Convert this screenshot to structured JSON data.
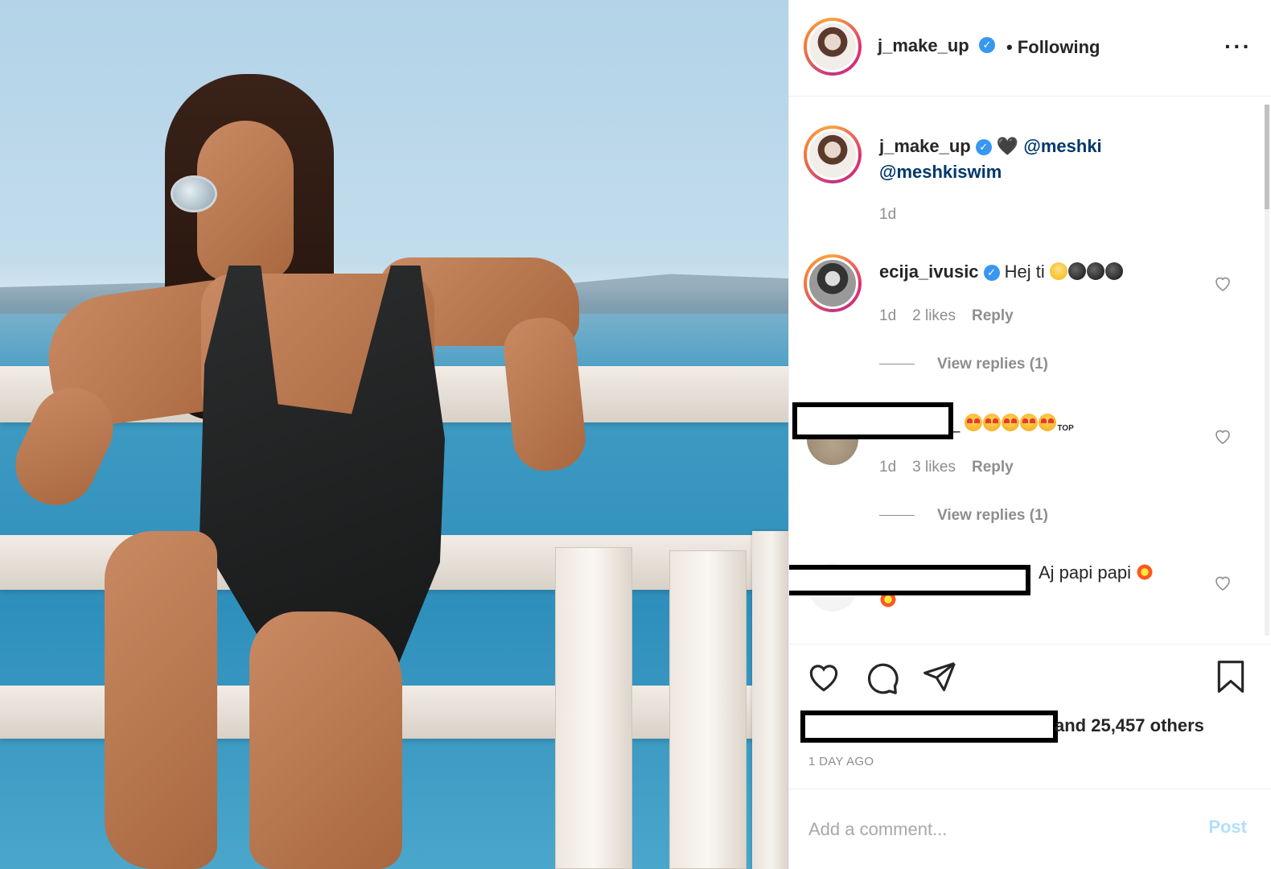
{
  "post_image": {
    "description_icon": "photo-icon"
  },
  "header": {
    "username": "j_make_up",
    "verified_icon": "verified-badge-icon",
    "follow_status": "• Following",
    "more_icon": "more-options-icon"
  },
  "caption": {
    "username": "j_make_up",
    "heart_emoji": "🖤",
    "mention_1": "@meshki",
    "mention_2": "@meshkiswim",
    "time": "1d"
  },
  "comments": [
    {
      "username": "ecija_ivusic",
      "text": "Hej ti",
      "time": "1d",
      "likes": "2 likes",
      "reply": "Reply",
      "view_replies": "View replies (1)"
    },
    {
      "username_suffix": "_",
      "text_tag": "TOP",
      "time": "1d",
      "likes": "3 likes",
      "reply": "Reply",
      "view_replies": "View replies (1)"
    },
    {
      "text": "Aj papi papi"
    }
  ],
  "actions": {
    "like_icon": "heart-icon",
    "comment_icon": "comment-icon",
    "share_icon": "share-icon",
    "save_icon": "bookmark-icon",
    "likes_text": "and 25,457 others",
    "posted_ago": "1 DAY AGO"
  },
  "add_comment": {
    "placeholder": "Add a comment...",
    "post_label": "Post"
  },
  "colors": {
    "text": "#262626",
    "muted": "#8e8e8e",
    "verified": "#3897f0",
    "mention": "#00376b",
    "post_disabled": "#b2dffc"
  }
}
